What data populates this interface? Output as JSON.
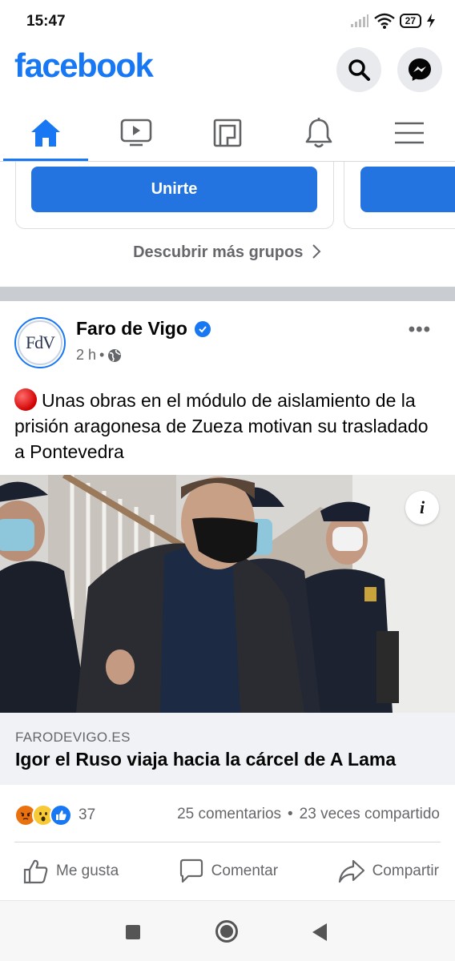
{
  "status_bar": {
    "time": "15:47",
    "battery": "27"
  },
  "header": {
    "logo": "facebook",
    "search_icon": "search-icon",
    "messenger_icon": "messenger-icon"
  },
  "tabs": [
    {
      "icon": "home-icon",
      "active": true
    },
    {
      "icon": "watch-icon",
      "active": false
    },
    {
      "icon": "feeds-icon",
      "active": false
    },
    {
      "icon": "bell-icon",
      "active": false
    },
    {
      "icon": "menu-icon",
      "active": false
    }
  ],
  "groups": {
    "join_label": "Unirte",
    "discover_label": "Descubrir más grupos"
  },
  "post": {
    "page_name": "Faro de Vigo",
    "avatar_text": "FdV",
    "time": "2 h",
    "text": "Unas obras en el módulo de aislamiento de la prisión aragonesa de Zueza motivan su trasladado a Pontevedra",
    "link": {
      "domain": "FARODEVIGO.ES",
      "title": "Igor el Ruso viaja hacia la cárcel de A Lama"
    },
    "info_label": "i",
    "reactions_count": "37",
    "comments": "25 comentarios",
    "dot": "•",
    "shares": "23 veces compartido",
    "actions": {
      "like": "Me gusta",
      "comment": "Comentar",
      "share": "Compartir"
    }
  },
  "colors": {
    "brand": "#1877f2",
    "join_button": "#2374e1",
    "secondary_text": "#65676b"
  }
}
